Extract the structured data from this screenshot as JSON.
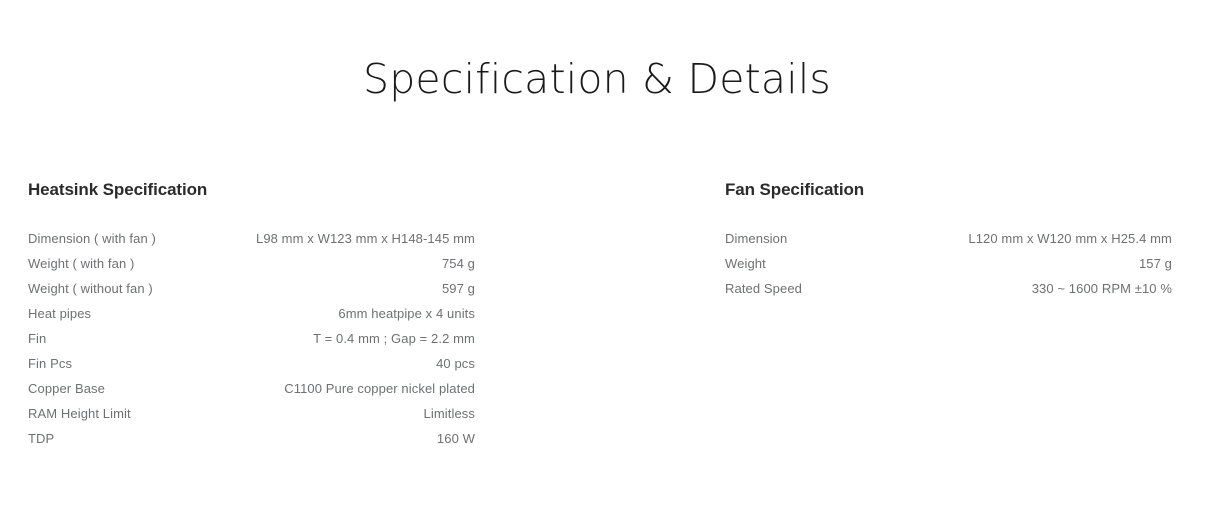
{
  "page": {
    "title": "Specification & Details",
    "background_color": "#ffffff",
    "title_color": "#1a1a1a",
    "heading_color": "#2b2b2b",
    "text_color": "#6e7073"
  },
  "sections": [
    {
      "heading": "Heatsink Specification",
      "rows": [
        {
          "label": "Dimension ( with fan )",
          "value": "L98 mm x W123 mm x H148-145 mm"
        },
        {
          "label": "Weight ( with fan )",
          "value": "754 g"
        },
        {
          "label": "Weight ( without fan )",
          "value": "597 g"
        },
        {
          "label": "Heat pipes",
          "value": "6mm heatpipe x 4 units"
        },
        {
          "label": "Fin",
          "value": "T = 0.4 mm ; Gap = 2.2 mm"
        },
        {
          "label": "Fin Pcs",
          "value": "40 pcs"
        },
        {
          "label": "Copper Base",
          "value": "C1100 Pure copper nickel plated"
        },
        {
          "label": "RAM Height Limit",
          "value": "Limitless"
        },
        {
          "label": "TDP",
          "value": "160 W"
        }
      ]
    },
    {
      "heading": "Fan Specification",
      "rows": [
        {
          "label": "Dimension",
          "value": "L120 mm x W120 mm x H25.4 mm"
        },
        {
          "label": "Weight",
          "value": "157 g"
        },
        {
          "label": "Rated Speed",
          "value": "330 ~ 1600 RPM ±10 %"
        }
      ]
    }
  ]
}
